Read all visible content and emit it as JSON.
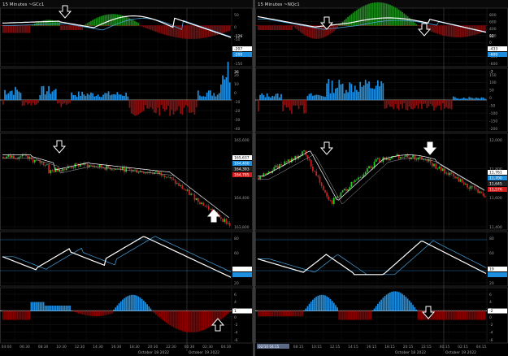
{
  "left": {
    "title": "15 Minutes ~GCc1",
    "osc1": {
      "ticks": [
        "50",
        "0",
        "-50",
        "-100",
        "-150"
      ],
      "val1": "-126",
      "val2": "-207",
      "val3": "-200"
    },
    "vol": {
      "ticks": [
        "20",
        "10",
        "0",
        "-10",
        "-20",
        "-30",
        "-40"
      ],
      "val": "36"
    },
    "price": {
      "ticks": [
        "165,600",
        "165,000",
        "164,400",
        "163,800"
      ],
      "val1": "165,637",
      "val2": "164,400",
      "val3": "164,393",
      "val4": "164,785"
    },
    "stoch": {
      "ticks": [
        "80",
        "60",
        "40",
        "20"
      ],
      "val1": "",
      "val2": ""
    },
    "hist": {
      "ticks": [
        "6",
        "4",
        "2",
        "0",
        "-2",
        "-4",
        "-6"
      ],
      "val": "1"
    },
    "time_ticks": [
      "04:00",
      "06:30",
      "08:30",
      "10:30",
      "12:30",
      "14:30",
      "16:30",
      "18:30",
      "20:30",
      "22:30",
      "00:30",
      "02:30",
      "04:30"
    ],
    "date1": "October 18 2022",
    "date2": "October 19 2022"
  },
  "right": {
    "title": "15 Minutes ~NQc1",
    "osc1": {
      "ticks": [
        "800",
        "600",
        "400",
        "200",
        "0",
        "-200",
        "-400",
        "-600"
      ],
      "val1": "92",
      "val2": "-433",
      "val3": "-600"
    },
    "vol": {
      "ticks": [
        "150",
        "100",
        "50",
        "0",
        "-50",
        "-100",
        "-150",
        "-200"
      ],
      "val": "-7"
    },
    "price": {
      "ticks": [
        "12,000",
        "11,800",
        "11,600",
        "11,400"
      ],
      "val1": "11,761",
      "val2": "11,700",
      "val3": "11,645",
      "val4": "11,576"
    },
    "stoch": {
      "ticks": [
        "80",
        "60",
        "40",
        "20"
      ],
      "val1": "19",
      "val2": ""
    },
    "hist": {
      "ticks": [
        "6",
        "4",
        "2",
        "0",
        "-2",
        "-4",
        "-6"
      ],
      "val": "-2"
    },
    "time_ticks": [
      "02:00",
      "06:15",
      "08:15",
      "10:15",
      "12:15",
      "14:15",
      "16:15",
      "18:15",
      "20:15",
      "22:15",
      "00:15",
      "02:15",
      "04:15"
    ],
    "cursor_label": "02/10 04:15",
    "date1": "October 18 2022",
    "date2": "October 19 2022"
  },
  "colors": {
    "up": "#1fd11f",
    "down": "#d21e1e",
    "hist_up": "#1e8fe0",
    "hist_down": "#8a0000",
    "grid": "#222",
    "border": "#444",
    "line_white": "#ffffff",
    "line_blue": "#4aa3df",
    "band": "#1c6fb0"
  }
}
